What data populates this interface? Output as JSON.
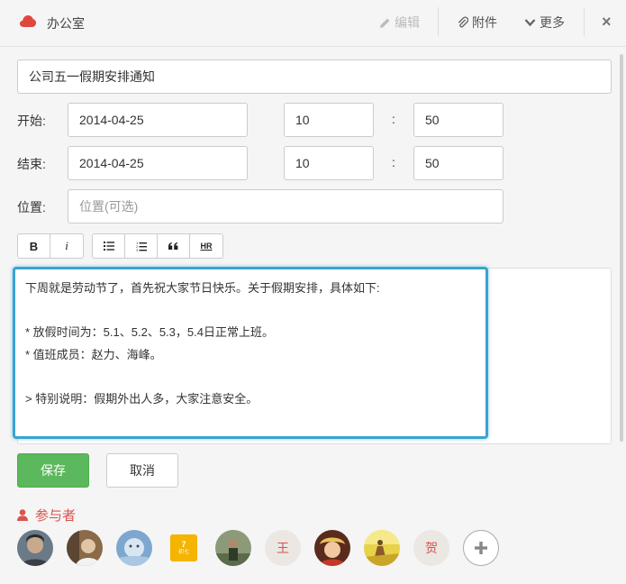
{
  "header": {
    "title": "办公室",
    "edit_label": "编辑",
    "attach_label": "附件",
    "more_label": "更多",
    "close_label": "×",
    "accent_color": "#e0483e"
  },
  "form": {
    "subject": "公司五一假期安排通知",
    "start": {
      "label": "开始:",
      "date": "2014-04-25",
      "hour": "10",
      "sep": ":",
      "minute": "50"
    },
    "end": {
      "label": "结束:",
      "date": "2014-04-25",
      "hour": "10",
      "sep": ":",
      "minute": "50"
    },
    "location": {
      "label": "位置:",
      "placeholder": "位置(可选)"
    }
  },
  "toolbar": {
    "bold": "B",
    "italic": "i",
    "hr": "HR"
  },
  "editor": {
    "lines": [
      "下周就是劳动节了，首先祝大家节日快乐。关于假期安排，具体如下:",
      "",
      "* 放假时间为：5.1、5.2、5.3，5.4日正常上班。",
      "* 值班成员：赵力、海峰。",
      "",
      "> 特别说明：假期外出人多，大家注意安全。"
    ]
  },
  "actions": {
    "save": "保存",
    "cancel": "取消"
  },
  "participants": {
    "title": "参与者",
    "calendar_avatar": {
      "day": "7",
      "sub": "初七"
    },
    "text_avatar_1": "王",
    "text_avatar_2": "贺",
    "add_label": "+"
  }
}
